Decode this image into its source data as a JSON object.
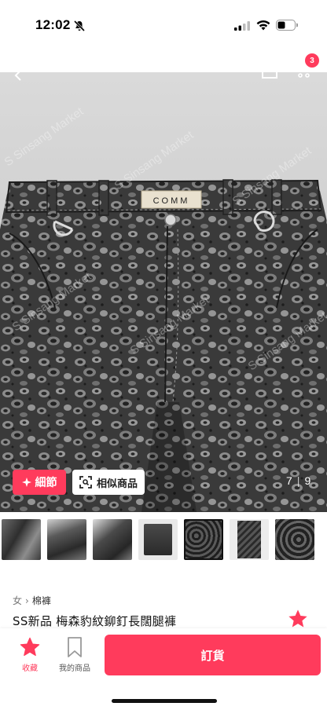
{
  "status_bar": {
    "time": "12:02",
    "icons": [
      "mute-icon",
      "signal-icon",
      "wifi-icon",
      "battery-icon"
    ]
  },
  "nav": {
    "cart_count": "3",
    "icons": [
      "back-icon",
      "share-icon",
      "cart-icon"
    ]
  },
  "hero": {
    "watermark": "S Sinsang Market",
    "waist_label": "COMM",
    "detail_button": "細節",
    "similar_button": "相似商品",
    "current_index": "7",
    "total_count": "9"
  },
  "thumbnails": [
    {
      "name": "thumb-1"
    },
    {
      "name": "thumb-2"
    },
    {
      "name": "thumb-3"
    },
    {
      "name": "thumb-4"
    },
    {
      "name": "thumb-5"
    },
    {
      "name": "thumb-6"
    },
    {
      "name": "thumb-7"
    }
  ],
  "product": {
    "breadcrumb": [
      "女",
      "棉褲"
    ],
    "title": "SS新品 梅森豹紋鉚釘長闊腿褲"
  },
  "bottom_bar": {
    "favorite_label": "收藏",
    "my_items_label": "我的商品",
    "order_button": "訂貨"
  },
  "colors": {
    "accent": "#ff3b5c",
    "denim_dark": "#2b2b2b",
    "denim_light": "#8a8a8a"
  }
}
